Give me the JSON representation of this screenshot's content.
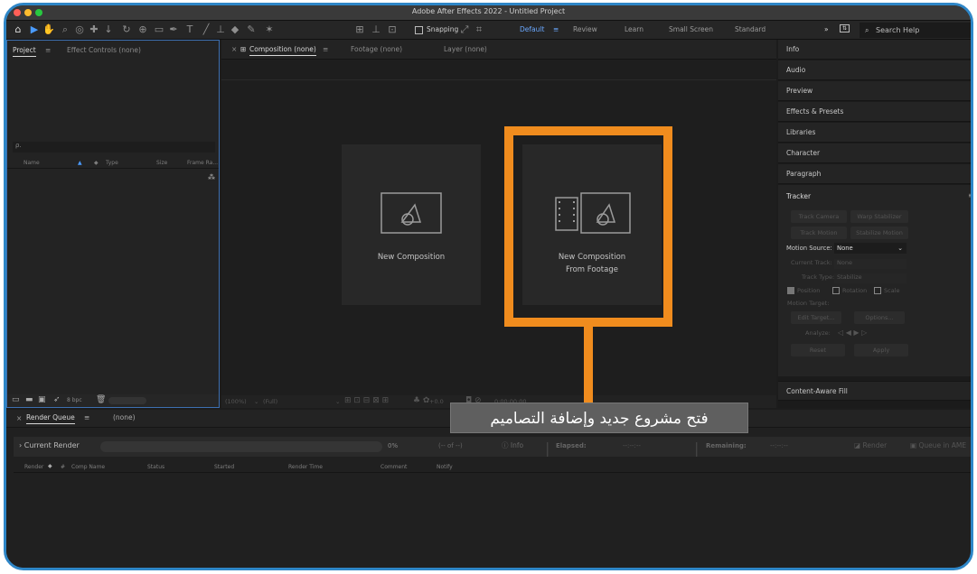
{
  "app": {
    "title": "Adobe After Effects 2022 - Untitled Project"
  },
  "toolbar": {
    "snapping_label": "Snapping",
    "workspaces": [
      "Default",
      "Review",
      "Learn",
      "Small Screen",
      "Standard"
    ],
    "workspace_more": "»",
    "search_placeholder": "Search Help"
  },
  "project_panel": {
    "tabs": [
      "Project",
      "Effect Controls (none)"
    ],
    "search_icon": "ρ.",
    "columns": [
      "Name",
      "Type",
      "Size",
      "Frame Ra..."
    ],
    "bpc_label": "8 bpc"
  },
  "composition_panel": {
    "tabs": [
      "Composition (none)",
      "Footage (none)",
      "Layer (none)"
    ],
    "cards": [
      {
        "label": "New Composition"
      },
      {
        "label": "New Composition From Footage"
      }
    ],
    "footer": {
      "zoom": "(100%)",
      "resolution": "(Full)",
      "exposure": "+0.0",
      "timecode": "0:00:00:00"
    }
  },
  "right_panel": {
    "items": [
      "Info",
      "Audio",
      "Preview",
      "Effects & Presets",
      "Libraries",
      "Character",
      "Paragraph"
    ],
    "tracker": {
      "title": "Tracker",
      "buttons_row1": [
        "Track Camera",
        "Warp Stabilizer"
      ],
      "buttons_row2": [
        "Track Motion",
        "Stabilize Motion"
      ],
      "motion_source_label": "Motion Source:",
      "motion_source_value": "None",
      "current_track_label": "Current Track:",
      "current_track_value": "None",
      "track_type_label": "Track Type:",
      "track_type_value": "Stabilize",
      "checkbox_position": "Position",
      "checkbox_rotation": "Rotation",
      "checkbox_scale": "Scale",
      "motion_target_label": "Motion Target:",
      "edit_target": "Edit Target...",
      "options": "Options...",
      "analyze_label": "Analyze:",
      "reset": "Reset",
      "apply": "Apply"
    },
    "content_aware_fill": "Content-Aware Fill"
  },
  "render_queue": {
    "tab": "Render Queue",
    "tab_other": "(none)",
    "current_render": "Current Render",
    "percent": "0%",
    "of": "(-- of --)",
    "info": "Info",
    "elapsed_label": "Elapsed:",
    "elapsed_value": "--:--:--",
    "remaining_label": "Remaining:",
    "remaining_value": "--:--:--",
    "render_button": "Render",
    "queue_ame": "Queue in AME",
    "columns": [
      "Render",
      "#",
      "Comp Name",
      "Status",
      "Started",
      "Render Time",
      "Comment",
      "Notify"
    ]
  },
  "callout": {
    "caption": "فتح مشروع جديد وإضافة التصاميم",
    "color": "#f08c1e"
  },
  "icons": [
    "home-icon",
    "selection-icon",
    "hand-icon",
    "zoom-icon",
    "orbit-icon",
    "pan-behind-icon",
    "shape-icon",
    "pen-icon",
    "text-icon",
    "brush-icon",
    "clone-icon",
    "eraser-icon",
    "roto-icon",
    "puppet-icon"
  ]
}
